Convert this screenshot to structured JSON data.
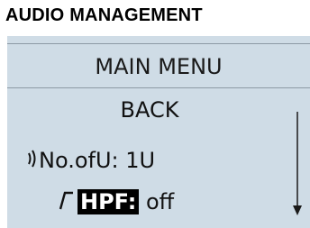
{
  "header": {
    "title": "AUDIO MANAGEMENT"
  },
  "menu": {
    "title": "MAIN MENU",
    "items": [
      {
        "label": "BACK"
      },
      {
        "icon": "signal-icon",
        "label": "No.ofU:",
        "value": "1U"
      },
      {
        "icon": "hpf-icon",
        "label": "HPF:",
        "value": "off"
      }
    ]
  },
  "scrollbar": {
    "icon": "scroll-down-arrow-icon"
  }
}
